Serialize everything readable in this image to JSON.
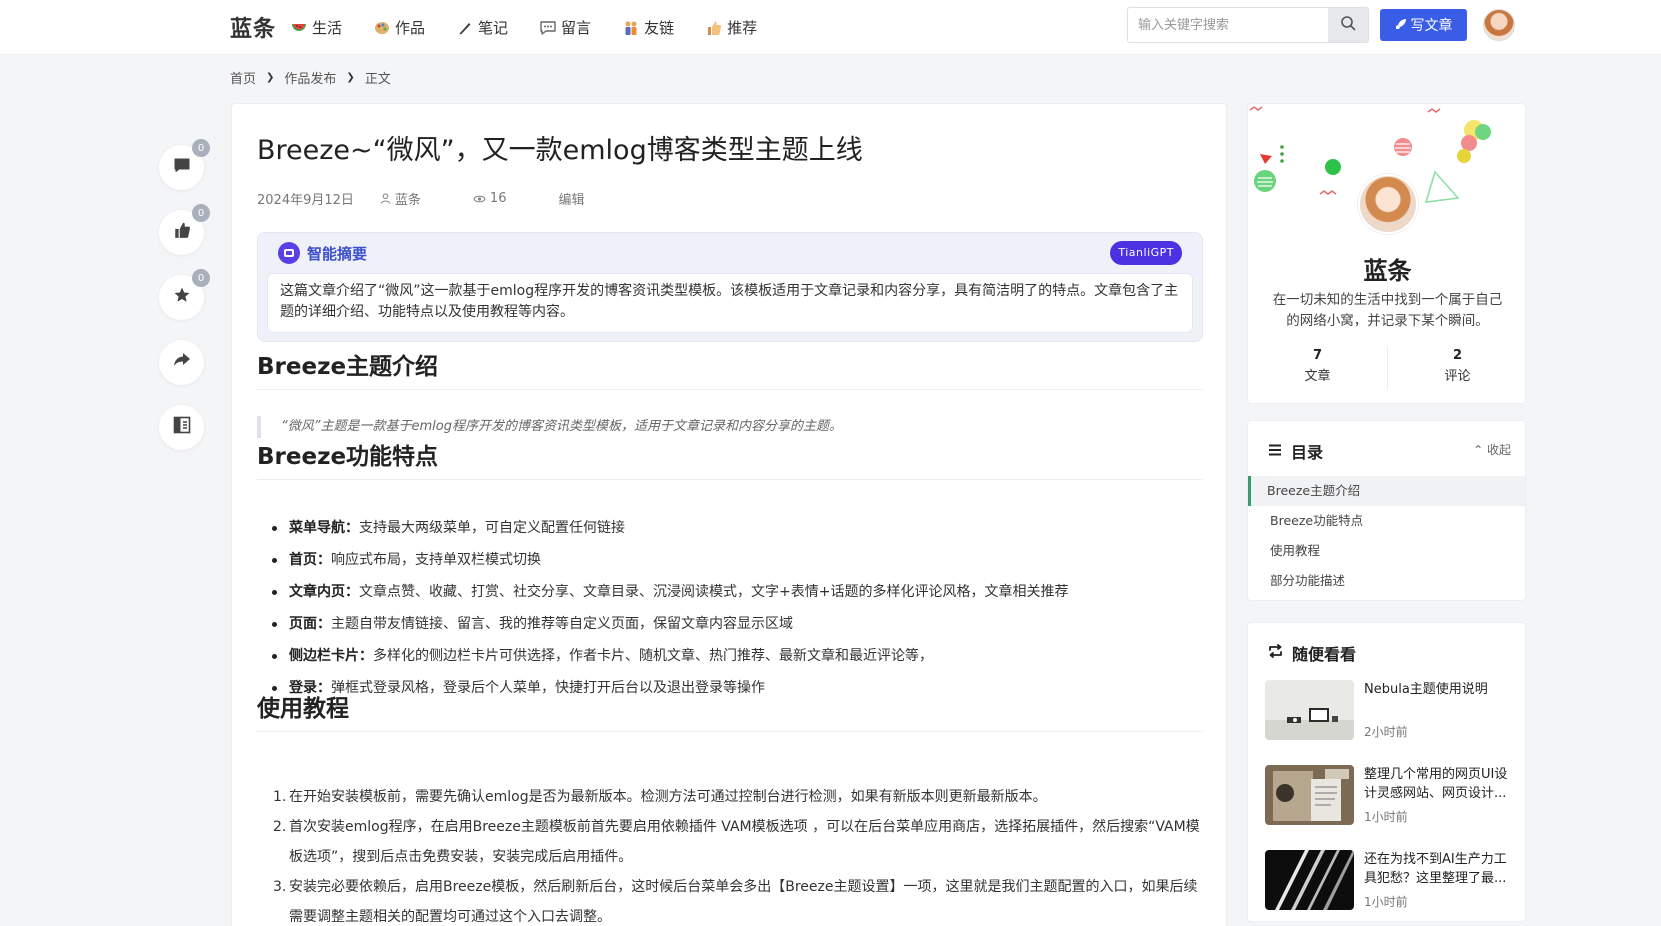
{
  "header": {
    "logo": "蓝条",
    "nav": [
      {
        "label": "生活",
        "icon": "watermelon-icon"
      },
      {
        "label": "作品",
        "icon": "palette-icon"
      },
      {
        "label": "笔记",
        "icon": "pen-icon"
      },
      {
        "label": "留言",
        "icon": "speech-bubble-icon"
      },
      {
        "label": "友链",
        "icon": "people-icon"
      },
      {
        "label": "推荐",
        "icon": "thumbs-up-icon"
      }
    ],
    "search_placeholder": "输入关键字搜索",
    "write_label": "写文章"
  },
  "breadcrumb": [
    "首页",
    "作品发布",
    "正文"
  ],
  "side_actions": [
    {
      "icon": "comment-icon",
      "count": "0"
    },
    {
      "icon": "like-icon",
      "count": "0"
    },
    {
      "icon": "star-icon",
      "count": "0"
    },
    {
      "icon": "share-icon"
    },
    {
      "icon": "reading-mode-icon"
    }
  ],
  "article": {
    "title": "Breeze~“微风”，又一款emlog博客类型主题上线",
    "date": "2024年9月12日",
    "author": "蓝条",
    "views": "16",
    "edit": "编辑",
    "summary": {
      "title": "智能摘要",
      "badge": "TianliGPT",
      "text": "这篇文章介绍了“微风”这一款基于emlog程序开发的博客资讯类型模板。该模板适用于文章记录和内容分享，具有简洁明了的特点。文章包含了主题的详细介绍、功能特点以及使用教程等内容。"
    },
    "h_intro": "Breeze主题介绍",
    "quote": "“微风”主题是一款基于emlog程序开发的博客资讯类型模板，适用于文章记录和内容分享的主题。",
    "h_features": "Breeze功能特点",
    "features": [
      {
        "label": "菜单导航：",
        "text": "支持最大两级菜单，可自定义配置任何链接"
      },
      {
        "label": "首页：",
        "text": "响应式布局，支持单双栏模式切换"
      },
      {
        "label": "文章内页：",
        "text": "文章点赞、收藏、打赏、社交分享、文章目录、沉浸阅读模式，文字+表情+话题的多样化评论风格，文章相关推荐"
      },
      {
        "label": "页面：",
        "text": "主题自带友情链接、留言、我的推荐等自定义页面，保留文章内容显示区域"
      },
      {
        "label": "侧边栏卡片：",
        "text": "多样化的侧边栏卡片可供选择，作者卡片、随机文章、热门推荐、最新文章和最近评论等，"
      },
      {
        "label": "登录：",
        "text": "弹框式登录风格，登录后个人菜单，快捷打开后台以及退出登录等操作"
      }
    ],
    "h_tutorial": "使用教程",
    "steps": [
      {
        "num": "1.",
        "text": "在开始安装模板前，需要先确认emlog是否为最新版本。检测方法可通过控制台进行检测，如果有新版本则更新最新版本。"
      },
      {
        "num": "2.",
        "text": "首次安装emlog程序，在启用Breeze主题模板前首先要启用依赖插件 VAM模板选项 ，可以在后台菜单应用商店，选择拓展插件，然后搜索“VAM模板选项”，搜到后点击免费安装，安装完成后启用插件。"
      },
      {
        "num": "3.",
        "text": "安装完必要依赖后，启用Breeze模板，然后刷新后台，这时候后台菜单会多出【Breeze主题设置】一项，这里就是我们主题配置的入口，如果后续需要调整主题相关的配置均可通过这个入口去调整。"
      }
    ]
  },
  "author_card": {
    "name": "蓝条",
    "desc": "在一切未知的生活中找到一个属于自己的网络小窝，并记录下某个瞬间。",
    "stats": [
      {
        "value": "7",
        "label": "文章"
      },
      {
        "value": "2",
        "label": "评论"
      }
    ]
  },
  "toc": {
    "title": "目录",
    "fold": "收起",
    "items": [
      "Breeze主题介绍",
      "Breeze功能特点",
      "使用教程",
      "部分功能描述"
    ]
  },
  "random": {
    "title": "随便看看",
    "items": [
      {
        "title": "Nebula主题使用说明",
        "time": "2小时前"
      },
      {
        "title": "整理几个常用的网页UI设计灵感网站、网页设计...",
        "time": "1小时前"
      },
      {
        "title": "还在为找不到AI生产力工具犯愁？这里整理了最...",
        "time": "1小时前"
      }
    ]
  },
  "colors": {
    "brand": "#3a5de8",
    "summary_accent": "#4a32e2",
    "toc_active": "#3a9b6a"
  }
}
